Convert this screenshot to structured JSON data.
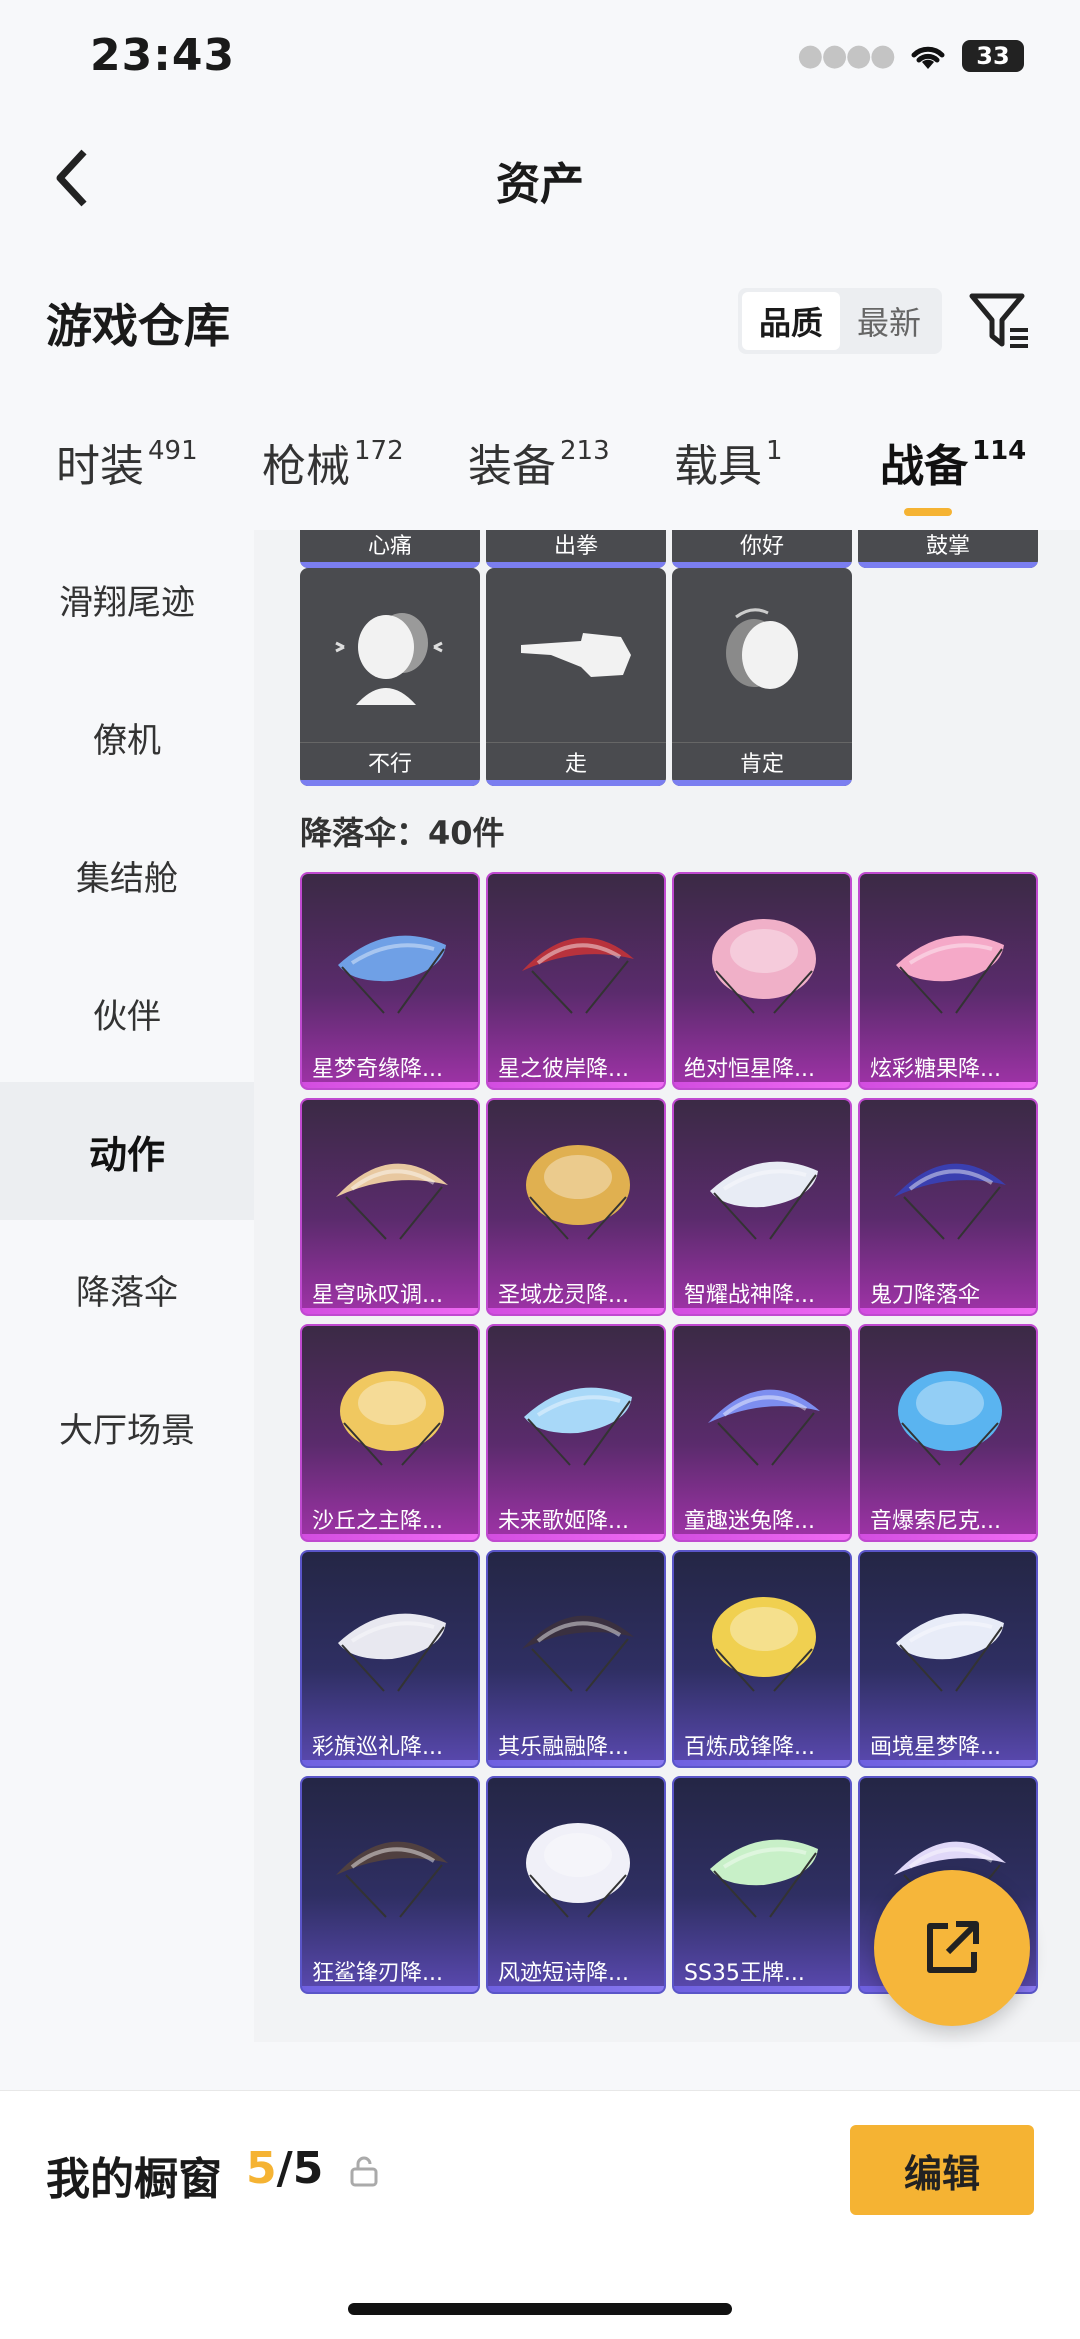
{
  "status": {
    "time": "23:43",
    "battery": "33"
  },
  "nav": {
    "title": "资产"
  },
  "header": {
    "title": "游戏仓库",
    "sort_options": [
      "品质",
      "最新"
    ]
  },
  "tabs": [
    {
      "label": "时装",
      "count": "491"
    },
    {
      "label": "枪械",
      "count": "172"
    },
    {
      "label": "装备",
      "count": "213"
    },
    {
      "label": "载具",
      "count": "1"
    },
    {
      "label": "战备",
      "count": "114"
    }
  ],
  "sidebar": [
    "滑翔尾迹",
    "僚机",
    "集结舱",
    "伙伴",
    "动作",
    "降落伞",
    "大厅场景"
  ],
  "actions": {
    "top_row": [
      "心痛",
      "出拳",
      "你好",
      "鼓掌"
    ],
    "row": [
      "不行",
      "走",
      "肯定"
    ]
  },
  "parachutes": {
    "header": "降落伞：40件",
    "items": [
      {
        "name": "星梦奇缘降...",
        "tier": "purple",
        "color": "#6fa0e6"
      },
      {
        "name": "星之彼岸降...",
        "tier": "purple",
        "color": "#b8323c"
      },
      {
        "name": "绝对恒星降...",
        "tier": "purple",
        "color": "#f0b0c8"
      },
      {
        "name": "炫彩糖果降...",
        "tier": "purple",
        "color": "#f5a9c8"
      },
      {
        "name": "星穹咏叹调...",
        "tier": "purple",
        "color": "#e8c8a0"
      },
      {
        "name": "圣域龙灵降...",
        "tier": "purple",
        "color": "#e0b050"
      },
      {
        "name": "智耀战神降...",
        "tier": "purple",
        "color": "#e8ecf5"
      },
      {
        "name": "鬼刀降落伞",
        "tier": "purple",
        "color": "#3a3fb0"
      },
      {
        "name": "沙丘之主降...",
        "tier": "purple",
        "color": "#f0c860"
      },
      {
        "name": "未来歌姬降...",
        "tier": "purple",
        "color": "#a8d8f8"
      },
      {
        "name": "童趣迷兔降...",
        "tier": "purple",
        "color": "#7d8ef0"
      },
      {
        "name": "音爆索尼克...",
        "tier": "purple",
        "color": "#5ab4f0"
      },
      {
        "name": "彩旗巡礼降...",
        "tier": "blue",
        "color": "#e8e8f0"
      },
      {
        "name": "其乐融融降...",
        "tier": "blue",
        "color": "#3a3040"
      },
      {
        "name": "百炼成锋降...",
        "tier": "blue",
        "color": "#f0d050"
      },
      {
        "name": "画境星梦降...",
        "tier": "blue",
        "color": "#e8ecf8"
      },
      {
        "name": "狂鲨锋刃降...",
        "tier": "blue",
        "color": "#504040"
      },
      {
        "name": "风迹短诗降...",
        "tier": "blue",
        "color": "#f0f0f8"
      },
      {
        "name": "SS35王牌...",
        "tier": "blue",
        "color": "#c8f0c8"
      },
      {
        "name": "",
        "tier": "blue",
        "color": "#e0d8f8"
      }
    ]
  },
  "showcase": {
    "title": "我的橱窗",
    "current": "5",
    "total": "/5",
    "edit_label": "编辑"
  },
  "colors": {
    "accent": "#f5b333"
  }
}
